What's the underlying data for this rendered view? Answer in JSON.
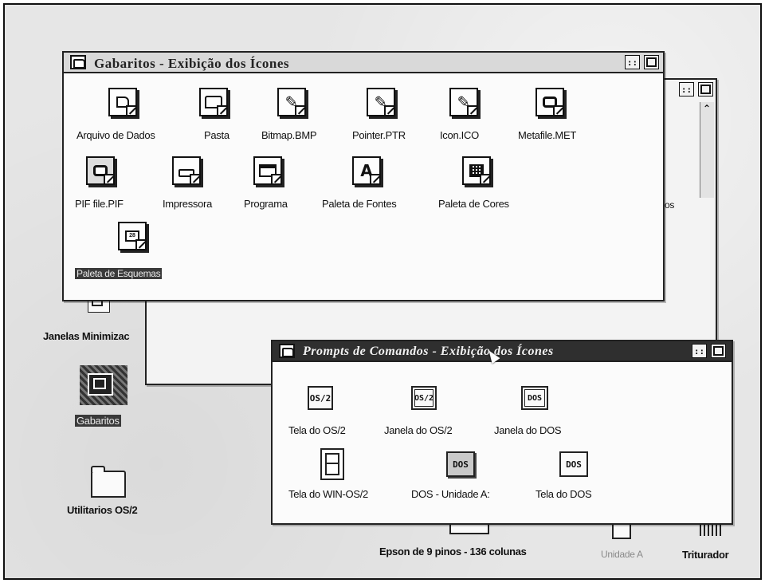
{
  "gabaritos_window": {
    "title": "Gabaritos - Exibição dos Ícones",
    "minimize_glyph": "::",
    "icons": [
      {
        "label": "Arquivo de Dados",
        "icon": "data-file-icon"
      },
      {
        "label": "Pasta",
        "icon": "folder-icon"
      },
      {
        "label": "Bitmap.BMP",
        "icon": "pencil-icon"
      },
      {
        "label": "Pointer.PTR",
        "icon": "pencil-icon"
      },
      {
        "label": "Icon.ICO",
        "icon": "pencil-icon"
      },
      {
        "label": "Metafile.MET",
        "icon": "monitor-icon"
      },
      {
        "label": "PIF file.PIF",
        "icon": "monitor-icon"
      },
      {
        "label": "Impressora",
        "icon": "printer-icon"
      },
      {
        "label": "Programa",
        "icon": "window-icon"
      },
      {
        "label": "Paleta de Fontes",
        "icon": "font-a-icon"
      },
      {
        "label": "Paleta de Cores",
        "icon": "color-grid-icon"
      },
      {
        "label": "Paleta de Esquemas",
        "icon": "scheme-icon",
        "selected": true
      }
    ]
  },
  "prompts_window": {
    "title": "Prompts de Comandos - Exibição dos Ícones",
    "minimize_glyph": "::",
    "icons": [
      {
        "label": "Tela do OS/2",
        "glyph": "OS/2"
      },
      {
        "label": "Janela do OS/2",
        "glyph": "OS/2"
      },
      {
        "label": "Janela do DOS",
        "glyph": "DOS"
      },
      {
        "label": "Tela do WIN-OS/2",
        "glyph": ""
      },
      {
        "label": "DOS - Unidade A:",
        "glyph": "DOS"
      },
      {
        "label": "Tela do DOS",
        "glyph": "DOS"
      }
    ]
  },
  "background_window": {
    "minimize_glyph": "::",
    "partial_text": "os"
  },
  "desktop": {
    "icons": [
      {
        "label": "Janelas Minimizac"
      },
      {
        "label": "Gabaritos",
        "selected": true
      },
      {
        "label": "Utilitarios OS/2"
      },
      {
        "label": "Epson de 9 pinos - 136 colunas"
      },
      {
        "label": "Unidade A",
        "faded": true
      },
      {
        "label": "Triturador"
      }
    ]
  },
  "colors": {
    "active_titlebar": "#2f2f2f",
    "inactive_titlebar": "#d9d9d9",
    "selection": "#3a3a3a"
  }
}
